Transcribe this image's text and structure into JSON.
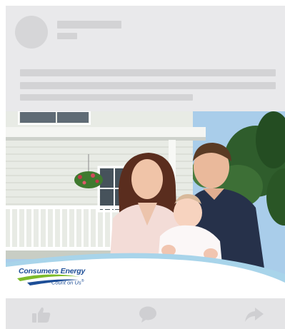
{
  "ad": {
    "brand_name": "Consumers Energy",
    "brand_tagline": "Count on Us",
    "registered_mark": "®"
  },
  "actions": {
    "like_icon": "thumbs-up-icon",
    "comment_icon": "speech-bubble-icon",
    "share_icon": "share-arrow-icon"
  },
  "colors": {
    "placeholder": "#d3d3d5",
    "card_background": "#e9e9eb",
    "action_icon": "#cfcfd2",
    "brand_blue": "#1d4e97",
    "brand_green": "#7dbb2a",
    "banner_swoosh": "#a8d4ea"
  }
}
